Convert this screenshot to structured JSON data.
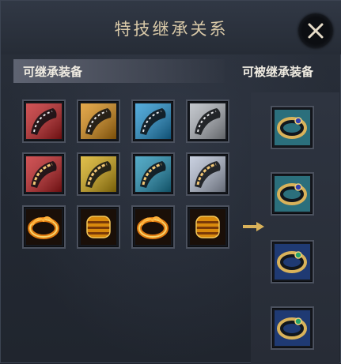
{
  "title": "特技继承关系",
  "left_header": "可继承装备",
  "right_header": "可被继承装备",
  "close_icon": "close-x-icon",
  "equipment_slots": [
    {
      "icon": "red-bracelet-icon",
      "color": "#c0191c"
    },
    {
      "icon": "orange-bracelet-icon",
      "color": "#d98a0d"
    },
    {
      "icon": "blue-bracelet-icon",
      "color": "#1a8fcf"
    },
    {
      "icon": "silver-bracelet-icon",
      "color": "#aeb3bb"
    },
    {
      "icon": "red-carved-bracelet-icon",
      "color": "#c0191c"
    },
    {
      "icon": "gold-carved-bracelet-icon",
      "color": "#d4a80c"
    },
    {
      "icon": "teal-carved-bracelet-icon",
      "color": "#1b8fb5"
    },
    {
      "icon": "silver-carved-bracelet-icon",
      "color": "#b5bfd4"
    },
    {
      "icon": "flame-ring-icon",
      "color": "#e07a10"
    },
    {
      "icon": "gold-wide-band-icon",
      "color": "#d98a0d"
    },
    {
      "icon": "flame-ring-icon",
      "color": "#e07a10"
    },
    {
      "icon": "gold-wide-band-icon",
      "color": "#d98a0d"
    }
  ],
  "target_slots": [
    {
      "icon": "teal-sapphire-bracelet-icon",
      "color": "#2b6f7c"
    },
    {
      "icon": "teal-sapphire-bracelet-icon",
      "color": "#2b6f7c"
    },
    {
      "icon": "blue-gold-emerald-bracelet-icon",
      "color": "#1f3a73"
    },
    {
      "icon": "blue-gold-emerald-bracelet-icon",
      "color": "#1f3a73"
    }
  ],
  "arrow_icon": "right-arrow-icon"
}
